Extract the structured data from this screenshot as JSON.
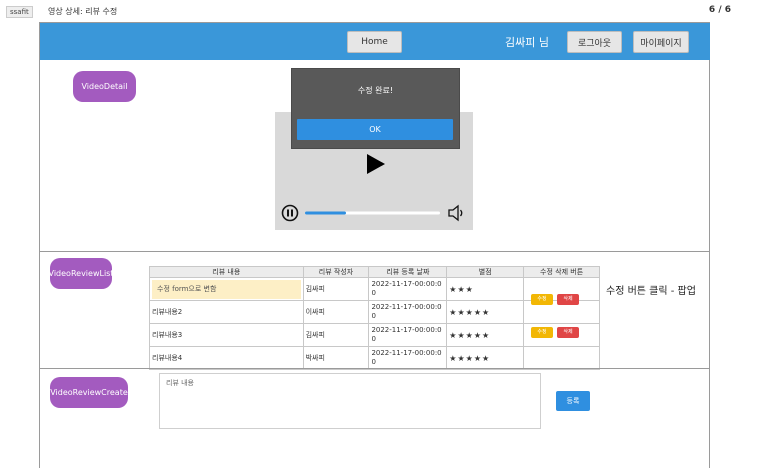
{
  "topbar": {
    "tag": "ssafit",
    "title": "영상 상세: 리뷰 수정",
    "page_count": "6 / 6"
  },
  "header": {
    "home_label": "Home",
    "user_name": "김싸피 님",
    "logout_label": "로그아웃",
    "mypage_label": "마이페이지"
  },
  "components": {
    "video_detail": "VideoDetail",
    "review_list": "VideoReviewList",
    "review_create": "VideoReviewCreate"
  },
  "popup": {
    "message": "수정 완료!",
    "ok_label": "OK"
  },
  "player": {
    "progress": 0.3,
    "colors": {
      "track": "#ffffff",
      "fill": "#2f8fe0"
    }
  },
  "reviews": {
    "columns": [
      "리뷰 내용",
      "리뷰 작성자",
      "리뷰 등록 날짜",
      "별점",
      "수정 삭제 버튼"
    ],
    "rows": [
      {
        "content": "수정 form으로 변함",
        "author": "김싸피",
        "date": "2022-11-17-00:00:0",
        "date_tail": "0",
        "stars": "★★★",
        "edit": "수정",
        "delete": "삭제"
      },
      {
        "content": "리뷰내용2",
        "author": "이싸피",
        "date": "2022-11-17-00:00:0",
        "date_tail": "0",
        "stars": "★★★★★",
        "edit": "",
        "delete": ""
      },
      {
        "content": "리뷰내용3",
        "author": "김싸피",
        "date": "2022-11-17-00:00:0",
        "date_tail": "0",
        "stars": "★★★★★",
        "edit": "수정",
        "delete": "삭제"
      },
      {
        "content": "리뷰내용4",
        "author": "박싸피",
        "date": "2022-11-17-00:00:0",
        "date_tail": "0",
        "stars": "★★★★★",
        "edit": "",
        "delete": ""
      }
    ],
    "side_note": "수정 버튼 클릭 - 팝업"
  },
  "create": {
    "placeholder": "리뷰 내용",
    "submit_label": "등록"
  },
  "theme": {
    "header_blue": "#3a97d9",
    "pill_purple": "#a35bbf",
    "edit_yellow": "#f2b705",
    "delete_red": "#e04646"
  }
}
